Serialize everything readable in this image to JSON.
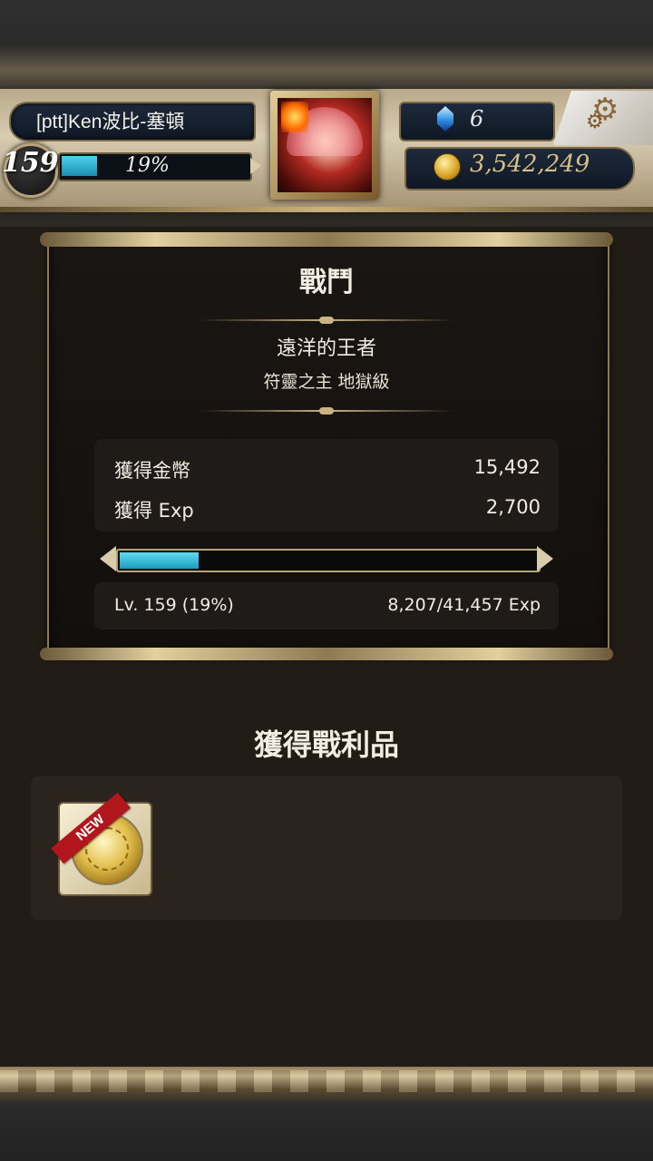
{
  "header": {
    "player_name": "[ptt]Ken波比-塞頓",
    "level": "159",
    "exp_percent_label": "19%",
    "exp_fraction": 0.19,
    "gems": "6",
    "coins": "3,542,249"
  },
  "battle": {
    "title": "戰鬥",
    "stage_name": "遠洋的王者",
    "stage_difficulty": "符靈之主 地獄級",
    "rewards": [
      {
        "label": "獲得金幣",
        "value": "15,492"
      },
      {
        "label": "獲得 Exp",
        "value": "2,700"
      }
    ],
    "exp_fraction": 0.19,
    "level_label": "Lv. 159 (19%)",
    "exp_label": "8,207/41,457 Exp"
  },
  "loot": {
    "title": "獲得戰利品",
    "items": [
      {
        "badge": "NEW",
        "icon": "gold-medal-card-icon"
      }
    ]
  },
  "colors": {
    "exp_fill": "#1c9bbd",
    "frame_gold": "#c9b482",
    "new_badge": "#b0161c"
  }
}
